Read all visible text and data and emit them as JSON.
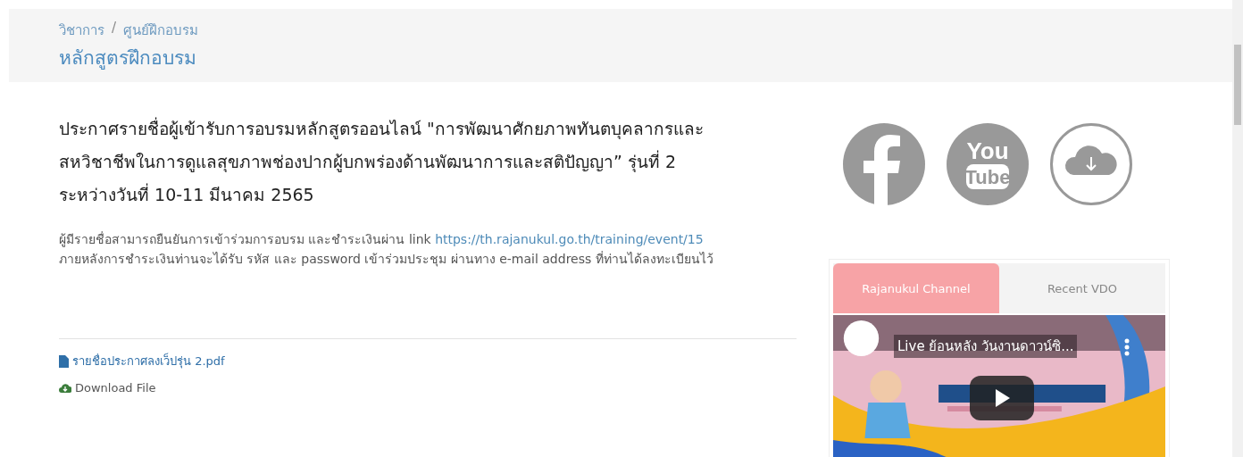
{
  "breadcrumb": [
    "วิชาการ",
    "ศูนย์ฝึกอบรม"
  ],
  "breadcrumb_separator": "/",
  "page_title": "หลักสูตรฝึกอบรม",
  "article": {
    "heading": [
      "ประกาศรายชื่อผู้เข้ารับการอบรมหลักสูตรออนไลน์ \"การพัฒนาศักยภาพทันตบุคลากรและ",
      "สหวิชาชีพในการดูแลสุขภาพช่องปากผู้บกพร่องด้านพัฒนาการและสติปัญญา” รุ่นที่ 2",
      "ระหว่างวันที่ 10-11 มีนาคม 2565"
    ],
    "body_lead": "ผู้มีรายชื่อสามารถยืนยันการเข้าร่วมการอบรม และชำระเงินผ่าน link ",
    "body_link": "https://th.rajanukul.go.th/training/event/15",
    "body_rest": "ภายหลังการชำระเงินท่านจะได้รับ รหัส และ password เข้าร่วมประชุม ผ่านทาง e-mail address ที่ท่านได้ลงทะเบียนไว้",
    "attachments": [
      {
        "kind": "file",
        "label": "รายชื่อประกาศลงเว็ปรุ่น 2.pdf"
      },
      {
        "kind": "download",
        "label": "Download File"
      }
    ]
  },
  "social": [
    {
      "kind": "facebook"
    },
    {
      "kind": "youtube",
      "lines": [
        "You",
        "Tube"
      ]
    },
    {
      "kind": "cloud"
    }
  ],
  "tabs": [
    {
      "label": "Rajanukul Channel",
      "selected": true
    },
    {
      "label": "Recent VDO",
      "selected": false
    }
  ],
  "video": {
    "kind": "picture",
    "title": "Live ย้อนหลัง วันงานดาวน์ซิ..."
  }
}
